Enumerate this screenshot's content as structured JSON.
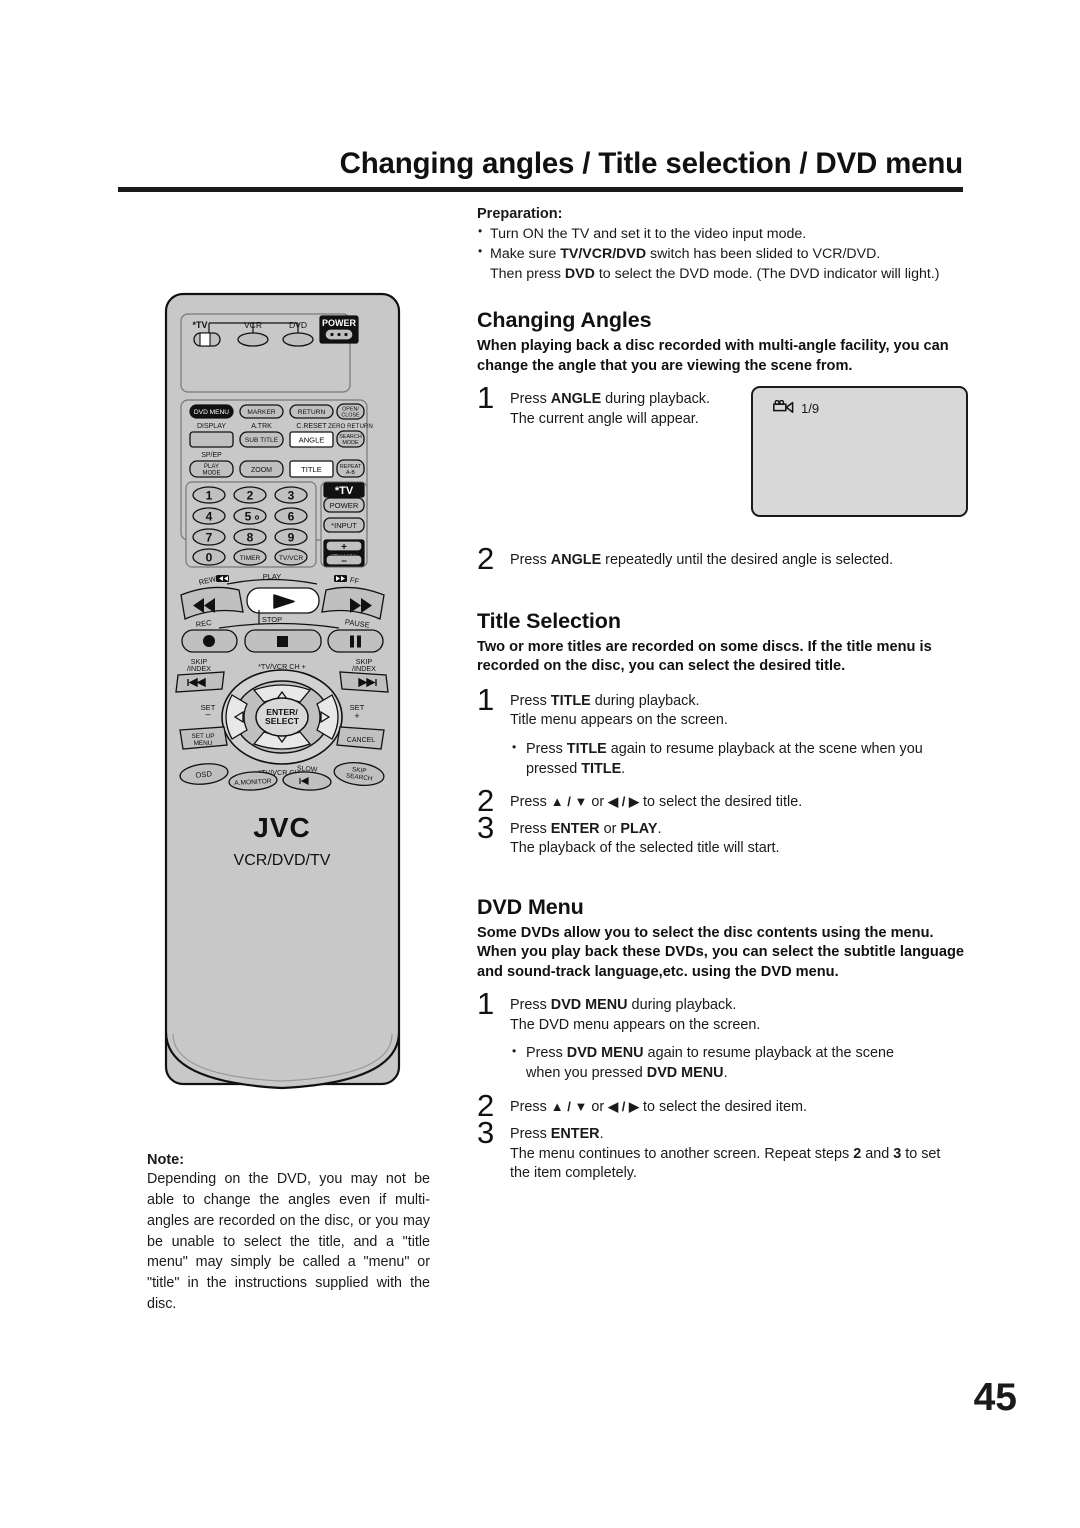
{
  "page": {
    "title": "Changing angles / Title selection / DVD menu",
    "number": "45"
  },
  "preparation": {
    "heading": "Preparation:",
    "items": [
      "Turn ON the TV and set it to the video input mode.",
      "Make sure TV/VCR/DVD switch has been slided to VCR/DVD.",
      "Then press DVD to select the DVD mode. (The DVD indicator will light.)"
    ]
  },
  "changing_angles": {
    "heading": "Changing Angles",
    "lead": "When playing back a disc recorded with multi-angle facility, you can change the angle that you are viewing the scene from.",
    "steps": [
      {
        "num": "1",
        "line1_a": "Press ",
        "line1_b": "ANGLE",
        "line1_c": " during playback.",
        "line2": "The current angle will appear."
      },
      {
        "num": "2",
        "line1_a": "Press ",
        "line1_b": "ANGLE",
        "line1_c": " repeatedly until the desired angle is selected."
      }
    ],
    "osd": {
      "icon": "camcorder-icon",
      "value": "1/9"
    }
  },
  "title_selection": {
    "heading": "Title Selection",
    "lead": "Two or more titles are recorded on some discs. If the title menu is recorded on the disc, you can select the desired title.",
    "steps": [
      {
        "num": "1",
        "line1_a": "Press ",
        "line1_b": "TITLE",
        "line1_c": " during playback.",
        "line2": "Title menu appears on the screen.",
        "bullet_a": "Press ",
        "bullet_b": "TITLE",
        "bullet_c": " again to resume playback at the scene when you pressed ",
        "bullet_d": "TITLE",
        "bullet_e": "."
      },
      {
        "num": "2",
        "pre": "Press ",
        "arrows1": "▲ / ▼",
        "mid": " or ",
        "arrows2": "◀ / ▶",
        "post": " to select the desired title."
      },
      {
        "num": "3",
        "line1_a": "Press ",
        "line1_b": "ENTER",
        "line1_c": " or ",
        "line1_d": "PLAY",
        "line1_e": ".",
        "line2": "The playback of the selected title will start."
      }
    ]
  },
  "dvd_menu": {
    "heading": "DVD Menu",
    "lead1": "Some DVDs allow you to select the disc contents using the menu.",
    "lead2": "When you play back these DVDs, you can select the subtitle language and sound-track language,etc. using the DVD menu.",
    "steps": [
      {
        "num": "1",
        "line1_a": "Press ",
        "line1_b": "DVD MENU",
        "line1_c": " during playback.",
        "line2": "The DVD menu appears on the screen.",
        "bullet_a": "Press ",
        "bullet_b": "DVD MENU",
        "bullet_c": " again to resume playback at the scene when you pressed ",
        "bullet_d": "DVD MENU",
        "bullet_e": "."
      },
      {
        "num": "2",
        "pre": "Press ",
        "arrows1": "▲ / ▼",
        "mid": " or ",
        "arrows2": "◀ / ▶",
        "post": " to select the desired item."
      },
      {
        "num": "3",
        "line1_a": "Press ",
        "line1_b": "ENTER",
        "line1_c": ".",
        "line2_a": "The menu continues to another screen. Repeat steps ",
        "line2_b": "2",
        "line2_c": " and ",
        "line2_d": "3",
        "line2_e": " to set the item completely."
      }
    ]
  },
  "note": {
    "label": "Note:",
    "text": "Depending on the DVD, you may not be able to change the angles even if multi-angles are recorded on the disc, or you may be unable to select the title, and a \"title menu\" may simply be called a \"menu\" or \"title\" in the instructions supplied with the disc."
  },
  "remote": {
    "brand": "JVC",
    "model": "VCR/DVD/TV",
    "mode_row": {
      "tv_label": "*TV",
      "vcr_label": "VCR",
      "dvd_label": "DVD",
      "power_label": "POWER"
    },
    "fn_grid": {
      "row1": [
        "DVD MENU",
        "MARKER",
        "RETURN",
        "OPEN/\nCLOSE"
      ],
      "row2_labels": [
        "DISPLAY",
        "A.TRK",
        "C.RESET",
        "ZERO RETURN"
      ],
      "row2": [
        "",
        "SUB TITLE",
        "ANGLE",
        "SEARCH\nMODE"
      ],
      "row3_labels": [
        "SP/EP",
        "",
        "",
        ""
      ],
      "row3": [
        "PLAY\nMODE",
        "ZOOM",
        "TITLE",
        "REPEAT\nA-B"
      ]
    },
    "keypad": [
      "1",
      "2",
      "3",
      "4",
      "5",
      "6",
      "7",
      "8",
      "9",
      "0",
      "TIMER",
      "TV/VCR"
    ],
    "tv_panel": {
      "tv_label": "*TV",
      "power": "POWER",
      "input": "*INPUT",
      "vol_plus": "+",
      "vol_label": "*TV VOL",
      "vol_minus": "–"
    },
    "transport": {
      "rew": "REW",
      "play": "PLAY",
      "ff": "FF",
      "rec": "REC",
      "stop": "STOP",
      "pause": "PAUSE"
    },
    "nav": {
      "skip_left": "SKIP\n/INDEX",
      "skip_right": "SKIP\n/INDEX",
      "ch_up": "*TV/VCR CH +",
      "ch_down": "*TV/VCR CH –",
      "set_minus": "SET\n–",
      "set_plus": "SET\n+",
      "enter": "ENTER/\nSELECT",
      "setup_menu": "SET UP\nMENU",
      "cancel": "CANCEL",
      "osd": "OSD",
      "a_monitor": "A.MONITOR",
      "slow": "SLOW",
      "skip_search": "SKIP\nSEARCH"
    }
  },
  "colors": {
    "remote_body": "#c8c8c8",
    "button_face": "#c0c0c0",
    "button_highlight": "#ffffff",
    "screen_fill": "#d8d8d8",
    "ink": "#1a1a1a"
  }
}
